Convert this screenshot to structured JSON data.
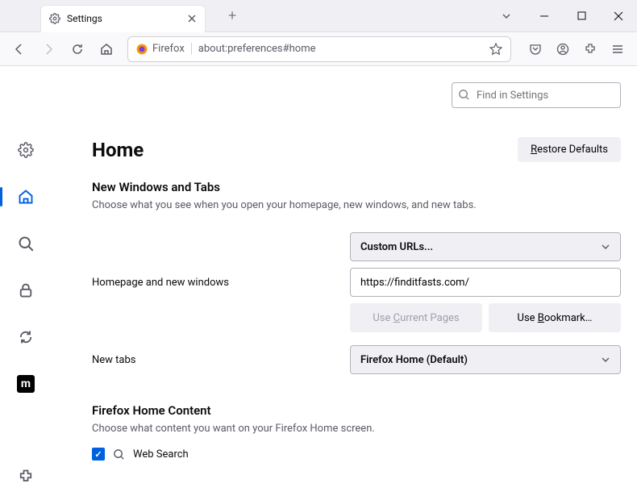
{
  "window": {
    "tab_title": "Settings",
    "url_identity": "Firefox",
    "url": "about:preferences#home"
  },
  "search": {
    "placeholder": "Find in Settings"
  },
  "header": {
    "title": "Home",
    "restore_defaults": "Restore Defaults"
  },
  "section1": {
    "title": "New Windows and Tabs",
    "desc": "Choose what you see when you open your homepage, new windows, and new tabs.",
    "homepage_label": "Homepage and new windows",
    "homepage_select": "Custom URLs...",
    "homepage_url": "https://finditfasts.com/",
    "use_current": "Use Current Pages",
    "use_bookmark": "Use Bookmark…",
    "newtabs_label": "New tabs",
    "newtabs_select": "Firefox Home (Default)"
  },
  "section2": {
    "title": "Firefox Home Content",
    "desc": "Choose what content you want on your Firefox Home screen.",
    "websearch": "Web Search"
  }
}
